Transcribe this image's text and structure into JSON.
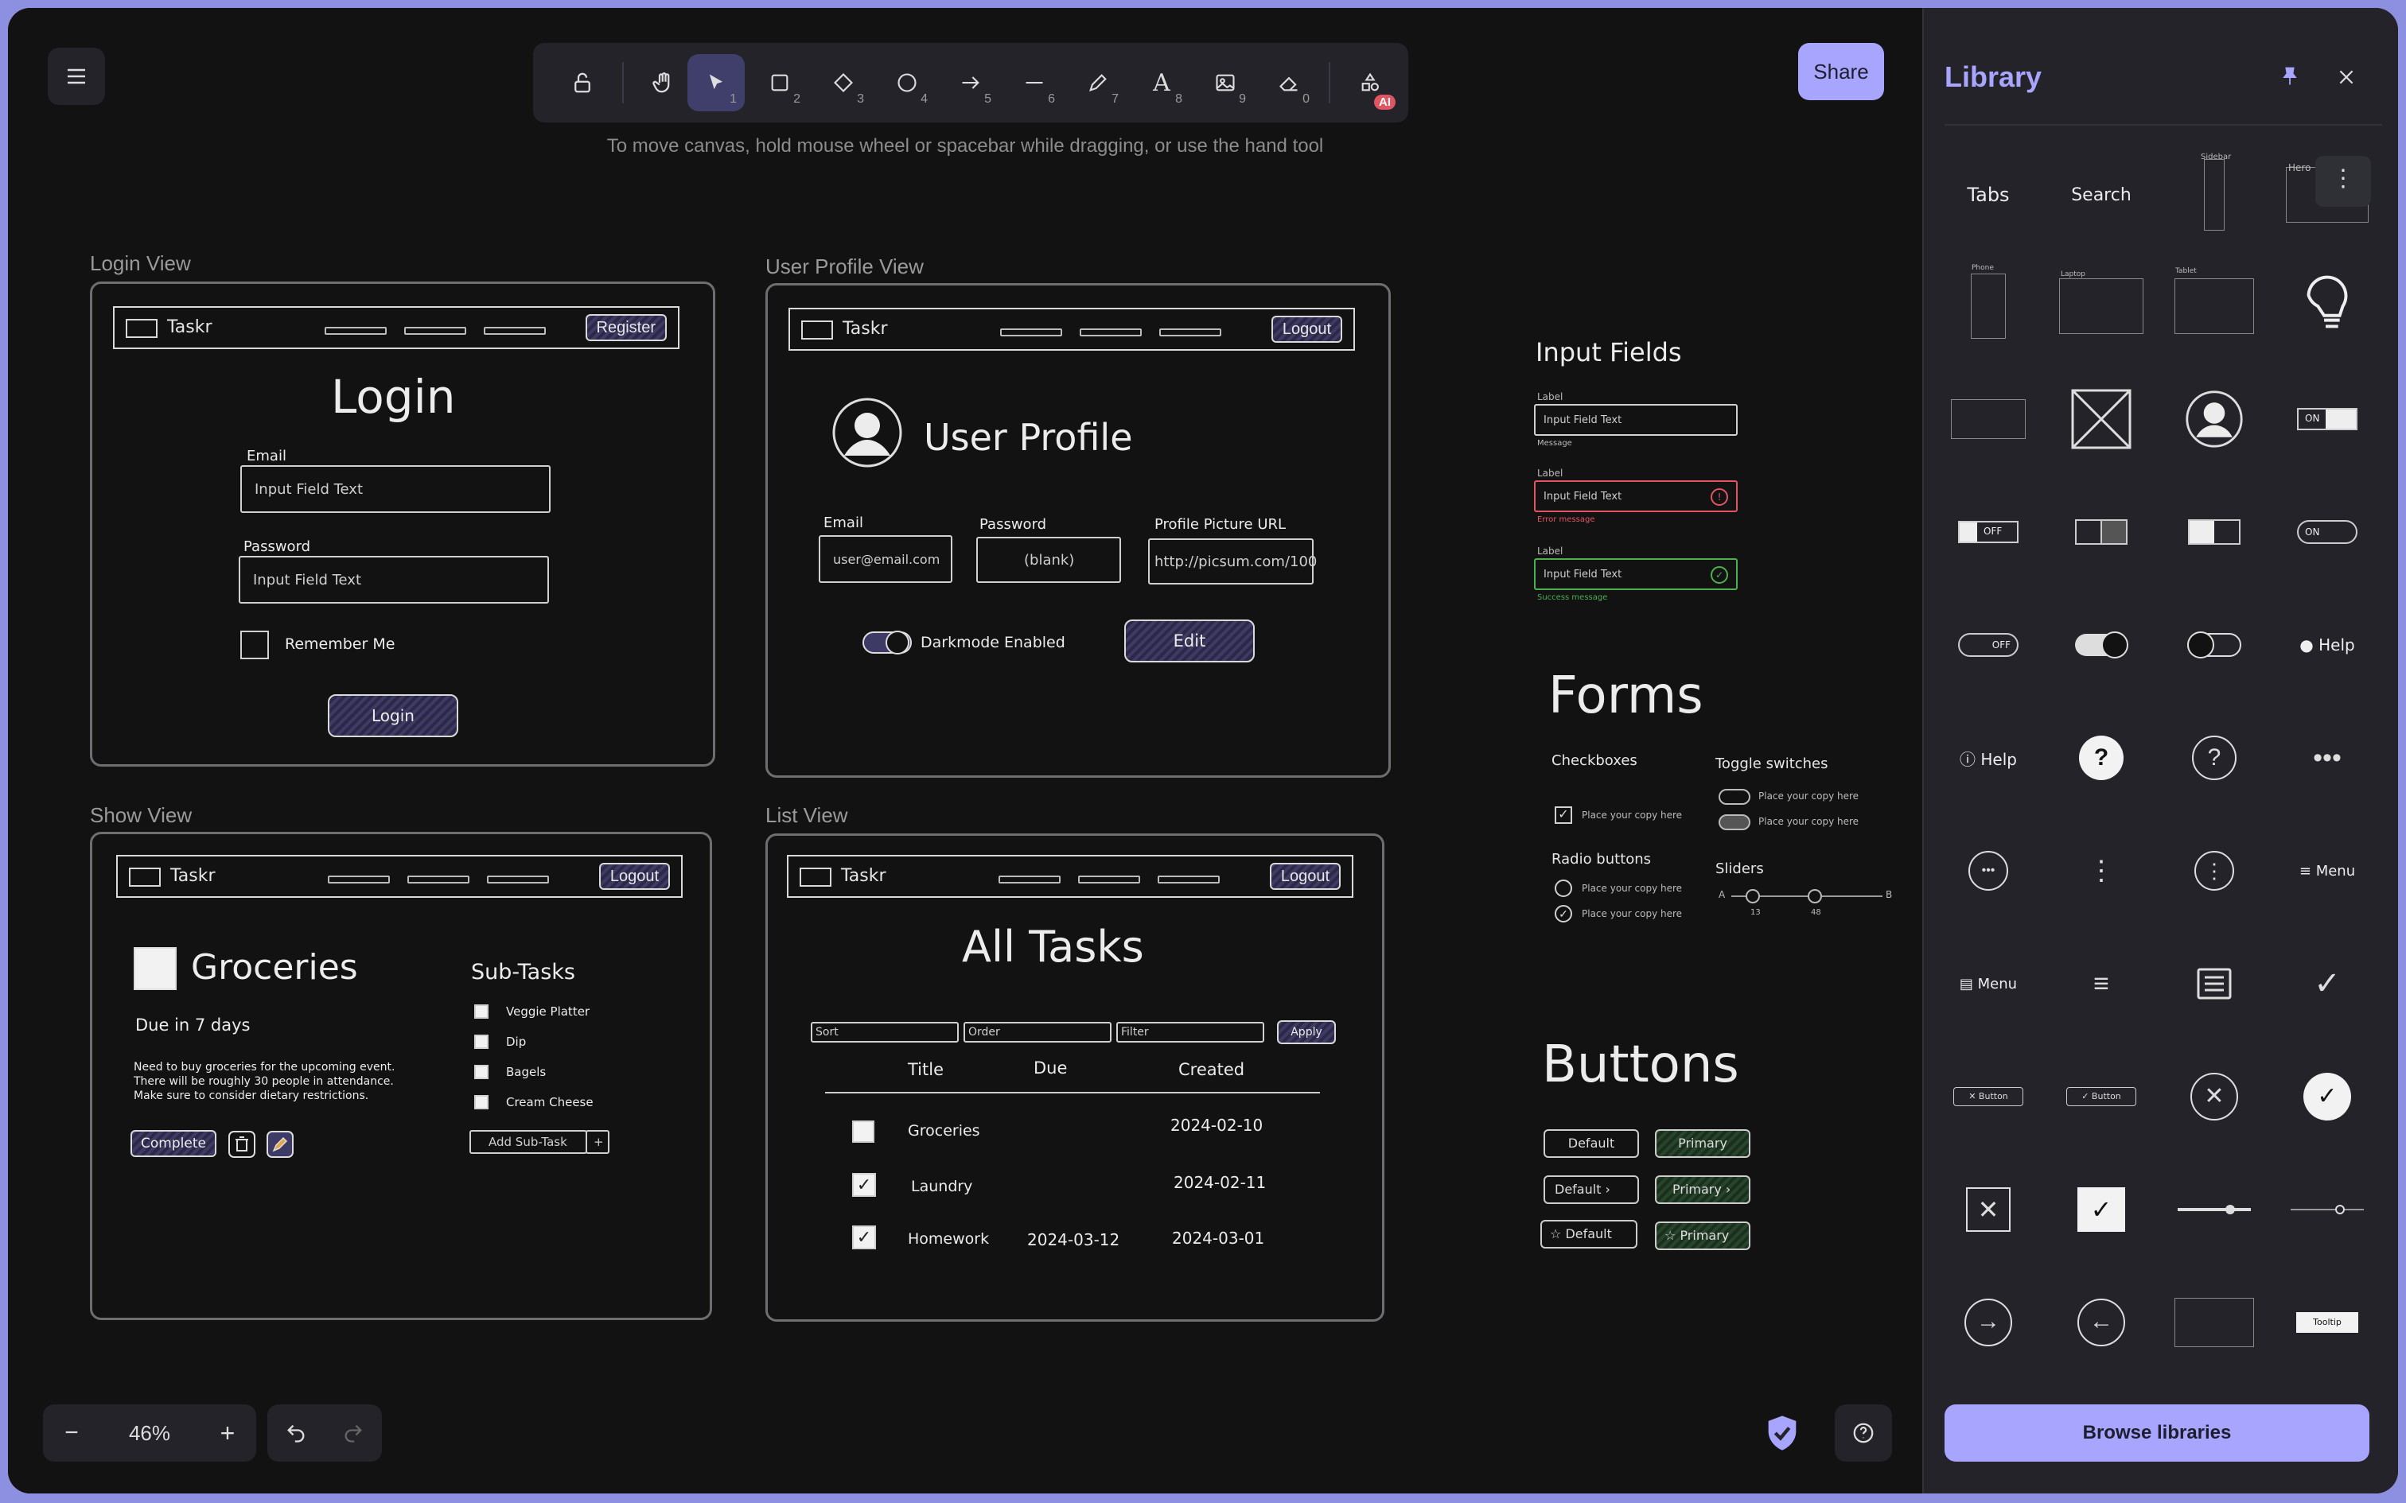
{
  "toolbar": {
    "menu_icon": "hamburger-icon",
    "tools": [
      {
        "name": "lock",
        "icon": "lock-icon",
        "key": ""
      },
      {
        "name": "hand",
        "icon": "hand-icon",
        "key": ""
      },
      {
        "name": "selection",
        "icon": "pointer-icon",
        "key": "1"
      },
      {
        "name": "rectangle",
        "icon": "rectangle-icon",
        "key": "2"
      },
      {
        "name": "diamond",
        "icon": "diamond-icon",
        "key": "3"
      },
      {
        "name": "ellipse",
        "icon": "ellipse-icon",
        "key": "4"
      },
      {
        "name": "arrow",
        "icon": "arrow-icon",
        "key": "5"
      },
      {
        "name": "line",
        "icon": "line-icon",
        "key": "6"
      },
      {
        "name": "draw",
        "icon": "pencil-icon",
        "key": "7"
      },
      {
        "name": "text",
        "icon": "text-icon",
        "key": "8"
      },
      {
        "name": "image",
        "icon": "image-icon",
        "key": "9"
      },
      {
        "name": "eraser",
        "icon": "eraser-icon",
        "key": "0"
      }
    ],
    "ai_badge": "AI",
    "share_label": "Share"
  },
  "hint": "To move canvas, hold mouse wheel or spacebar while dragging, or use the hand tool",
  "frames": {
    "login": {
      "label": "Login View",
      "brand": "Taskr",
      "nav_button": "Register",
      "title": "Login",
      "email_label": "Email",
      "email_placeholder": "Input Field Text",
      "password_label": "Password",
      "password_placeholder": "Input Field Text",
      "remember": "Remember Me",
      "submit": "Login"
    },
    "profile": {
      "label": "User Profile View",
      "brand": "Taskr",
      "nav_button": "Logout",
      "title": "User Profile",
      "email_label": "Email",
      "email_value": "user@email.com",
      "password_label": "Password",
      "password_value": "(blank)",
      "picture_label": "Profile Picture URL",
      "picture_value": "http://picsum.com/100",
      "darkmode": "Darkmode Enabled",
      "edit": "Edit"
    },
    "show": {
      "label": "Show View",
      "brand": "Taskr",
      "nav_button": "Logout",
      "title": "Groceries",
      "due": "Due in 7 days",
      "description": "Need to buy groceries for the upcoming event. There will be roughly 30 people in attendance. Make sure to consider dietary restrictions.",
      "complete": "Complete",
      "subtasks_title": "Sub-Tasks",
      "subtasks": [
        "Veggie Platter",
        "Dip",
        "Bagels",
        "Cream Cheese"
      ],
      "add_subtask": "Add Sub-Task",
      "add_plus": "+"
    },
    "list": {
      "label": "List View",
      "brand": "Taskr",
      "nav_button": "Logout",
      "title": "All Tasks",
      "sort": "Sort",
      "order": "Order",
      "filter": "Filter",
      "apply": "Apply",
      "columns": [
        "Title",
        "Due",
        "Created"
      ],
      "rows": [
        {
          "title": "Groceries",
          "due": "",
          "created": "2024-02-10",
          "checked": false
        },
        {
          "title": "Laundry",
          "due": "",
          "created": "2024-02-11",
          "checked": true
        },
        {
          "title": "Homework",
          "due": "2024-03-12",
          "created": "2024-03-01",
          "checked": true
        }
      ]
    }
  },
  "components": {
    "input_fields_title": "Input Fields",
    "label": "Label",
    "field_text": "Input Field Text",
    "message": "Message",
    "error_message": "Error message",
    "success_message": "Success message",
    "forms_title": "Forms",
    "checkboxes": "Checkboxes",
    "toggle_switches": "Toggle switches",
    "radio_buttons": "Radio buttons",
    "sliders": "Sliders",
    "copy": "Place your copy here",
    "slider_a": "A",
    "slider_b": "B",
    "slider_v1": "13",
    "slider_v2": "48",
    "buttons_title": "Buttons",
    "default": "Default",
    "primary": "Primary"
  },
  "bottom": {
    "zoom": "46%",
    "zoom_out": "−",
    "zoom_in": "+"
  },
  "library": {
    "title": "Library",
    "browse": "Browse libraries",
    "items_text": {
      "tabs": "Tabs",
      "search": "Search",
      "sidebar": "Sidebar",
      "hero": "Hero",
      "phone": "Phone",
      "laptop": "Laptop",
      "tablet": "Tablet",
      "on": "ON",
      "off": "OFF",
      "help": "Help",
      "menu": "Menu",
      "button": "Button",
      "tooltip": "Tooltip"
    }
  }
}
